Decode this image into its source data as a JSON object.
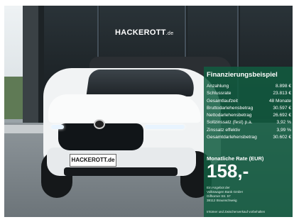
{
  "dealer": {
    "sign_name": "HACKEROTT",
    "sign_suffix": ".de",
    "plate_text": "HACKEROTT.de"
  },
  "finance": {
    "title": "Finanzierungsbeispiel",
    "rows": [
      {
        "label": "Anzahlung",
        "value": "8.898 €"
      },
      {
        "label": "Schlussrate",
        "value": "23.813 €"
      },
      {
        "label": "Gesamtlaufzeit",
        "value": "48 Monate"
      },
      {
        "label": "Bruttodarlehensbetrag",
        "value": "30.597 €"
      },
      {
        "label": "Nettodarlehensbetrag",
        "value": "26.692 €"
      },
      {
        "label": "Sollzinssatz (fest) p.a.",
        "value": "3,92 %"
      },
      {
        "label": "Zinssatz effektiv",
        "value": "3,99 %"
      },
      {
        "label": "Gesamtdarlehensbetrag",
        "value": "30.602 €"
      }
    ],
    "monthly_label": "Monatliche Rate (EUR)",
    "monthly_value": "158,-",
    "address": [
      "Ein Angebot der",
      "Volkswagen Bank GmbH",
      "Gifhorner Str. 57",
      "38112 Braunschweig"
    ],
    "footnote": "Irrtümer und Zwischenverkauf vorbehalten"
  }
}
